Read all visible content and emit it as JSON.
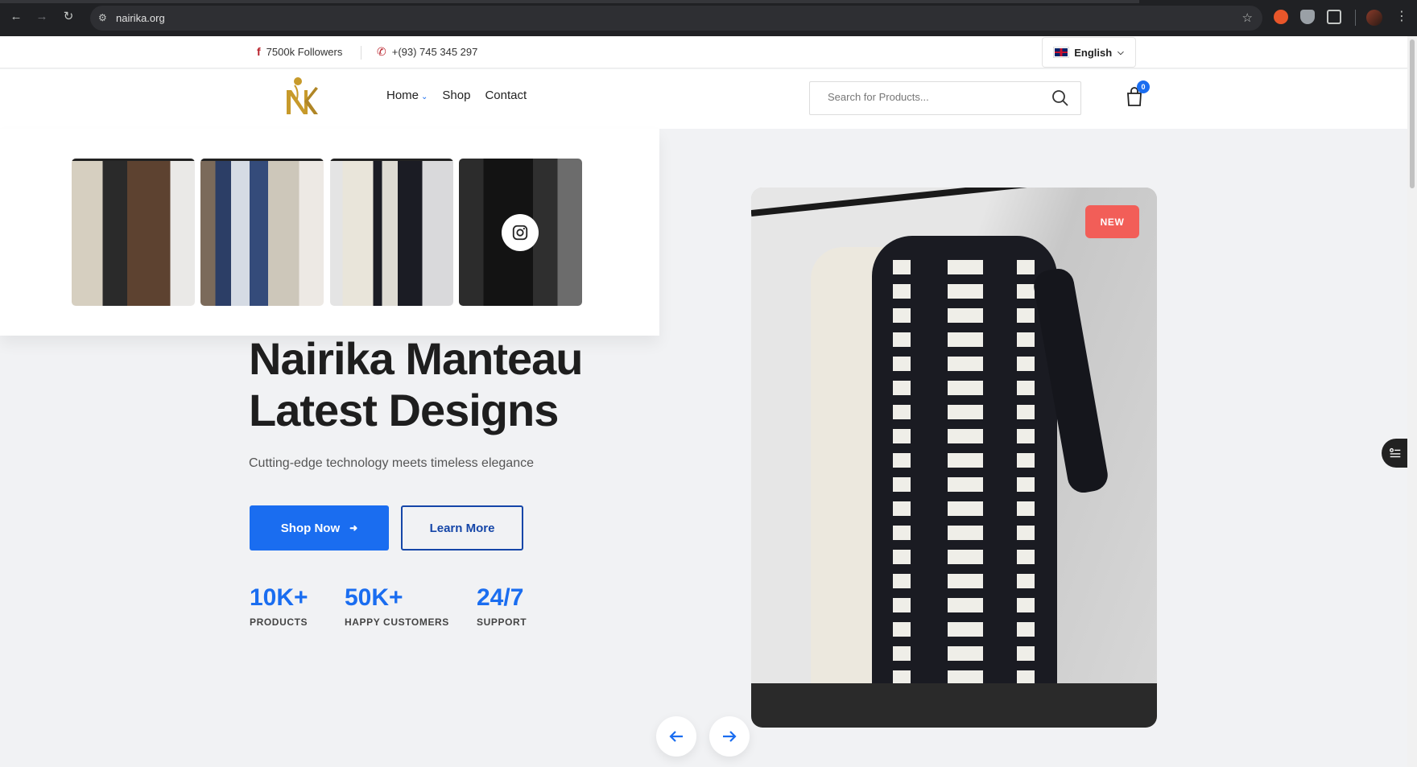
{
  "browser": {
    "url": "nairika.org",
    "icons": [
      "back-icon",
      "forward-icon",
      "reload-icon",
      "site-info-icon",
      "bookmark-star-icon",
      "extension-icon",
      "shield-icon",
      "puzzle-icon",
      "profile-avatar",
      "menu-icon"
    ]
  },
  "topbar": {
    "facebook_followers": "7500k Followers",
    "phone": "+(93) 745 345 297",
    "language": "English"
  },
  "header": {
    "nav": [
      "Home",
      "Shop",
      "Contact"
    ],
    "search_placeholder": "Search for Products...",
    "cart_count": "0"
  },
  "hero": {
    "title_line1": "Nairika Manteau",
    "title_line2": "Latest Designs",
    "subtitle": "Cutting-edge technology meets timeless elegance",
    "primary_button": "Shop Now",
    "secondary_button": "Learn More",
    "badge": "NEW",
    "stats": [
      {
        "value": "10K+",
        "label": "PRODUCTS"
      },
      {
        "value": "50K+",
        "label": "HAPPY CUSTOMERS"
      },
      {
        "value": "24/7",
        "label": "SUPPORT"
      }
    ]
  },
  "colors": {
    "accent": "#1a6df0",
    "badge": "#f25e58",
    "brand_gold": "#c79a2b"
  }
}
